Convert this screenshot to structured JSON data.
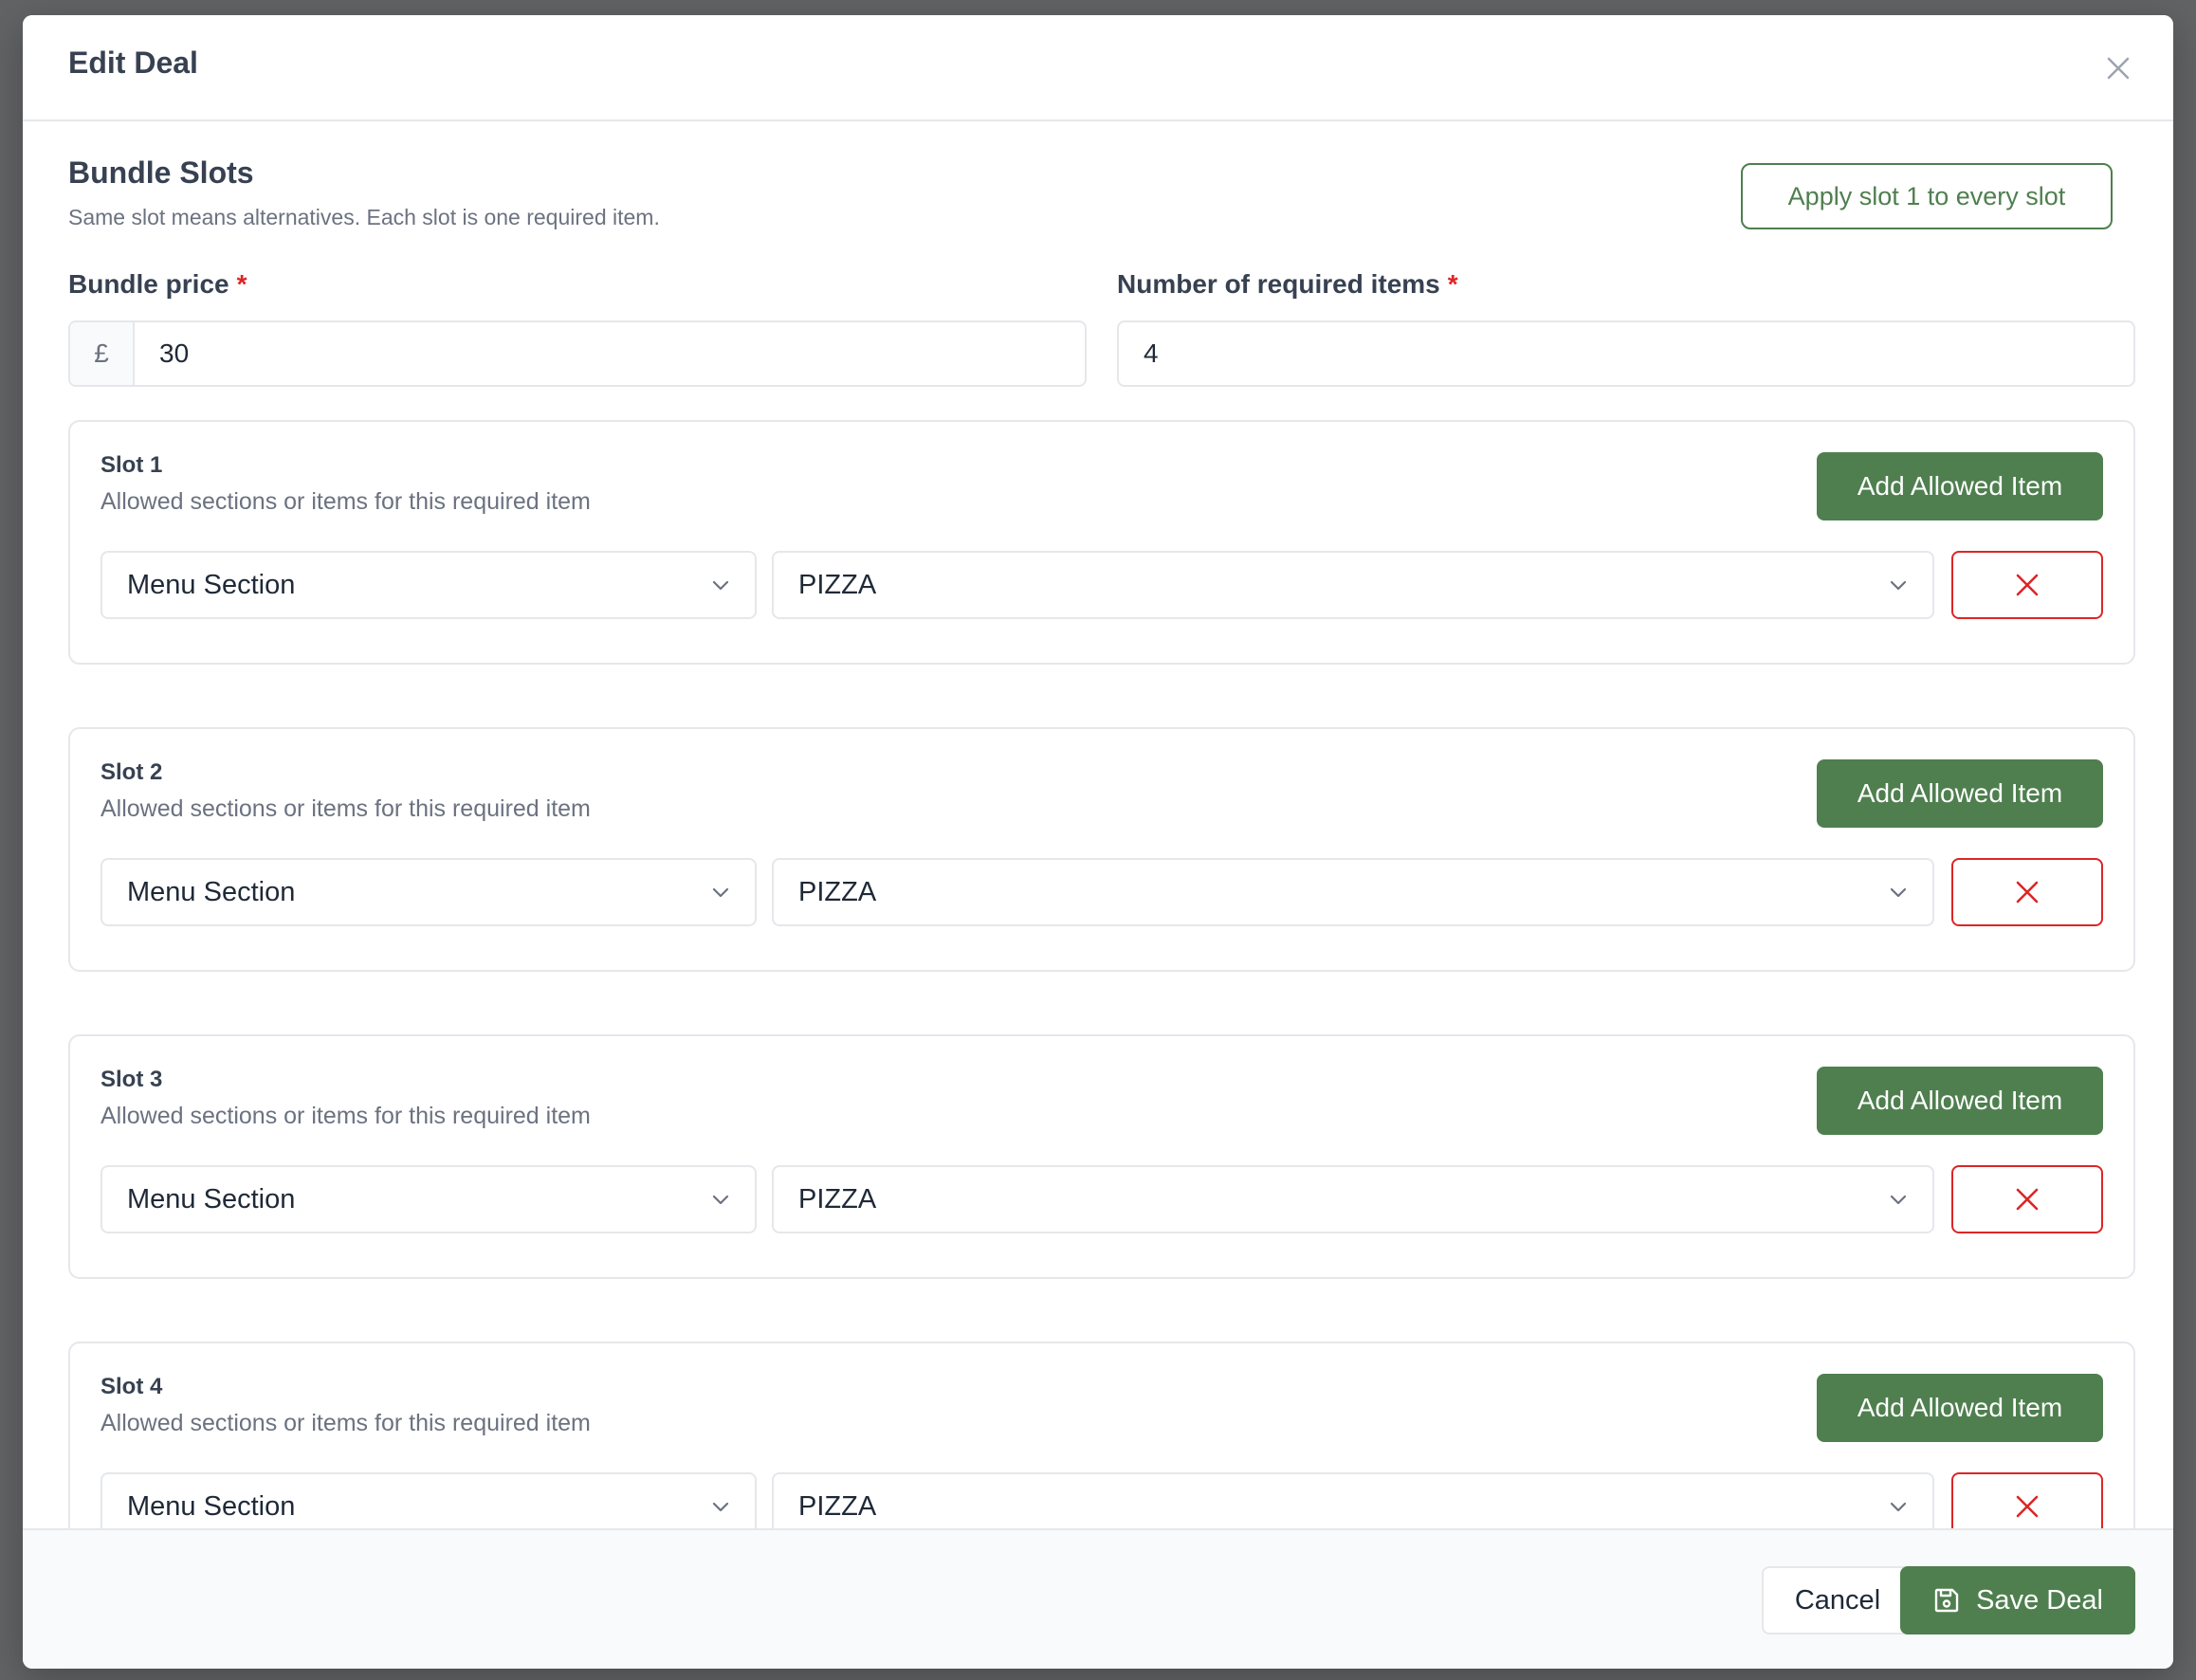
{
  "dialog": {
    "title": "Edit Deal"
  },
  "bundle": {
    "section_title": "Bundle Slots",
    "section_desc": "Same slot means alternatives. Each slot is one required item.",
    "apply_button": "Apply slot 1 to every slot",
    "price_label": "Bundle price",
    "price_required_mark": "*",
    "currency_symbol": "£",
    "price_value": "30",
    "count_label": "Number of required items",
    "count_required_mark": "*",
    "count_value": "4"
  },
  "slots": [
    {
      "title": "Slot 1",
      "desc": "Allowed sections or items for this required item",
      "add_label": "Add Allowed Item",
      "type": "Menu Section",
      "value": "PIZZA"
    },
    {
      "title": "Slot 2",
      "desc": "Allowed sections or items for this required item",
      "add_label": "Add Allowed Item",
      "type": "Menu Section",
      "value": "PIZZA"
    },
    {
      "title": "Slot 3",
      "desc": "Allowed sections or items for this required item",
      "add_label": "Add Allowed Item",
      "type": "Menu Section",
      "value": "PIZZA"
    },
    {
      "title": "Slot 4",
      "desc": "Allowed sections or items for this required item",
      "add_label": "Add Allowed Item",
      "type": "Menu Section",
      "value": "PIZZA"
    }
  ],
  "footer": {
    "cancel_label": "Cancel",
    "save_label": "Save Deal"
  },
  "icons": {
    "close": "close-icon",
    "chevron": "chevron-down-icon",
    "remove": "x-icon",
    "save": "save-icon"
  },
  "colors": {
    "primary": "#4f7f4f",
    "danger": "#dc2626",
    "backdrop": "#626365"
  }
}
